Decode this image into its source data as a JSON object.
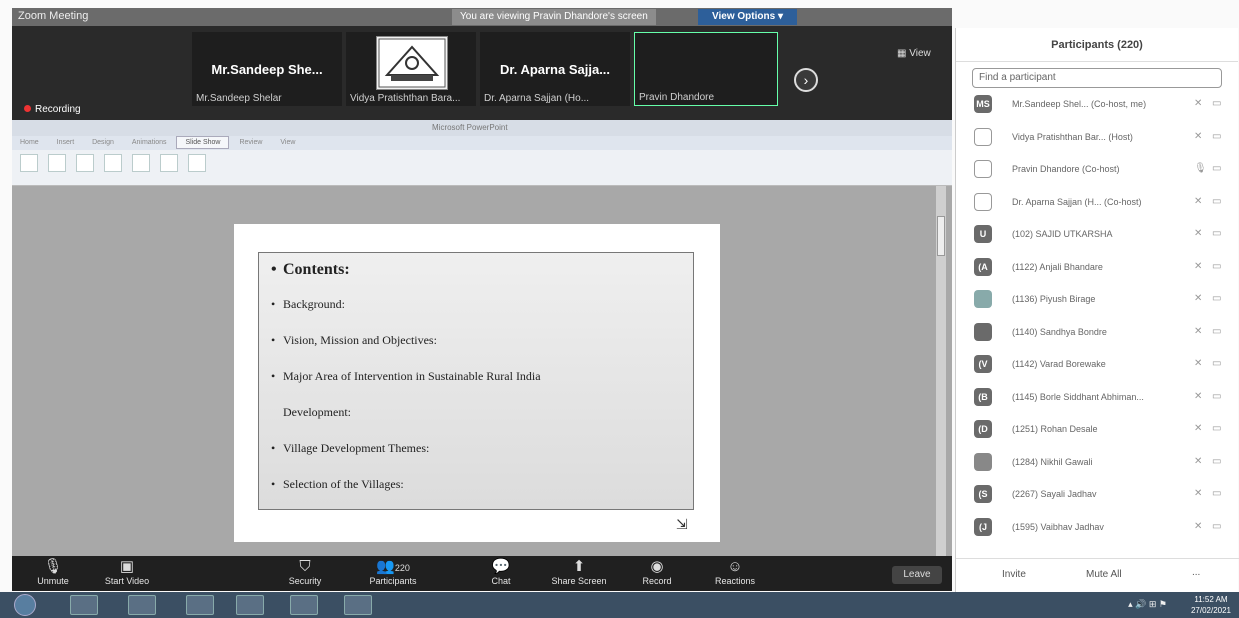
{
  "zoom": {
    "window_title": "Zoom Meeting",
    "viewing_banner": "You are viewing Pravin Dhandore's screen",
    "view_options": "View Options ▾",
    "view_button": "▦ View",
    "recording": "Recording",
    "tiles": [
      {
        "big": "Mr.Sandeep She...",
        "small": "Mr.Sandeep Shelar"
      },
      {
        "big": "",
        "small": "Vidya Pratishthan Bara..."
      },
      {
        "big": "Dr. Aparna Sajja...",
        "small": "Dr. Aparna Sajjan (Ho..."
      },
      {
        "big": "",
        "small": "Pravin Dhandore"
      }
    ]
  },
  "ppt": {
    "title": "Microsoft PowerPoint",
    "tabs": [
      "Home",
      "Insert",
      "Design",
      "Animations",
      "Slide Show",
      "Review",
      "View"
    ],
    "active_tab": "Slide Show",
    "slide": {
      "heading": "Contents:",
      "bullets": [
        "Background:",
        "Vision, Mission and Objectives:",
        "Major Area of Intervention in Sustainable  Rural India",
        "Development:",
        "Village Development Themes:",
        "Selection of the Villages:"
      ]
    }
  },
  "controls": {
    "unmute": "Unmute",
    "start_video": "Start Video",
    "security": "Security",
    "participants": "Participants",
    "participants_count": "220",
    "chat": "Chat",
    "share_screen": "Share Screen",
    "record": "Record",
    "reactions": "Reactions",
    "leave": "Leave"
  },
  "panel": {
    "title": "Participants (220)",
    "search_placeholder": "Find a participant",
    "participants": [
      {
        "initials": "MS",
        "name": "Mr.Sandeep Shel... (Co-host, me)"
      },
      {
        "initials": "",
        "name": "Vidya Pratishthan Bar... (Host)"
      },
      {
        "initials": "",
        "name": "Pravin Dhandore (Co-host)"
      },
      {
        "initials": "",
        "name": "Dr. Aparna Sajjan (H... (Co-host)"
      },
      {
        "initials": "U",
        "name": "(102) SAJID UTKARSHA"
      },
      {
        "initials": "(A",
        "name": "(1122) Anjali Bhandare"
      },
      {
        "initials": "",
        "name": "(1136) Piyush Birage"
      },
      {
        "initials": "",
        "name": "(1140) Sandhya Bondre"
      },
      {
        "initials": "(V",
        "name": "(1142) Varad Borewake"
      },
      {
        "initials": "(B",
        "name": "(1145) Borle Siddhant Abhiman..."
      },
      {
        "initials": "(D",
        "name": "(1251) Rohan Desale"
      },
      {
        "initials": "",
        "name": "(1284) Nikhil Gawali"
      },
      {
        "initials": "(S",
        "name": "(2267) Sayali Jadhav"
      },
      {
        "initials": "(J",
        "name": "(1595) Vaibhav Jadhav"
      }
    ],
    "invite": "Invite",
    "mute_all": "Mute All",
    "more": "..."
  },
  "taskbar": {
    "time": "11:52 AM",
    "date": "27/02/2021"
  }
}
